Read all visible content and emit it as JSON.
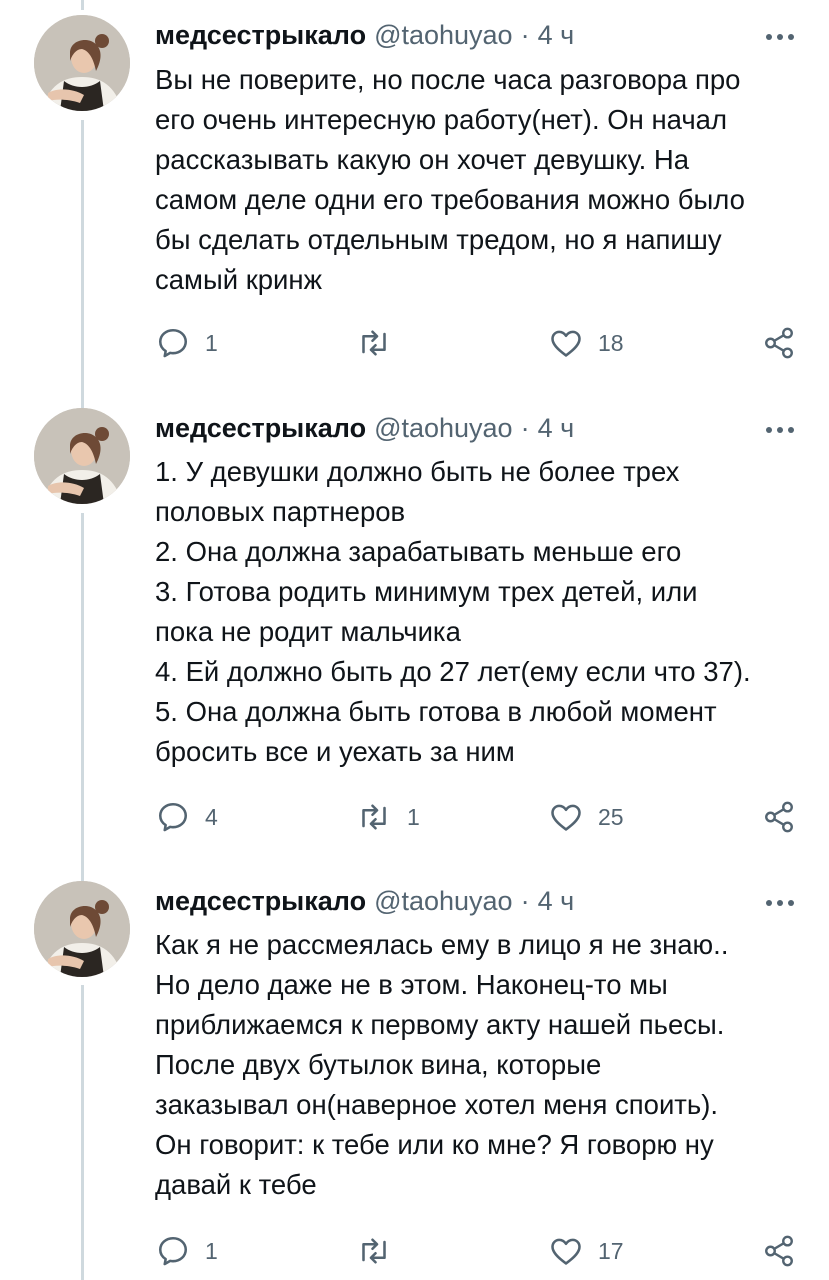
{
  "tweets": [
    {
      "name": "медсестрыкало",
      "handle": "@taohuyao",
      "separator": "·",
      "time": "4 ч",
      "lines": [
        "Вы не поверите, но после часа разговора про",
        "его очень интересную работу(нет). Он начал",
        "рассказывать какую он хочет девушку. На",
        "самом деле одни его требования можно было",
        "бы сделать отдельным тредом, но я напишу",
        "самый кринж"
      ],
      "replies": "1",
      "retweets": "",
      "likes": "18"
    },
    {
      "name": "медсестрыкало",
      "handle": "@taohuyao",
      "separator": "·",
      "time": "4 ч",
      "lines": [
        "1. У девушки должно быть не более трех",
        "половых партнеров",
        "2. Она должна зарабатывать меньше его",
        "3. Готова родить минимум трех детей, или",
        "пока не родит мальчика",
        "4. Ей должно быть до 27 лет(ему если что 37).",
        "5. Она должна быть готова в любой момент",
        "бросить все и уехать за ним"
      ],
      "replies": "4",
      "retweets": "1",
      "likes": "25"
    },
    {
      "name": "медсестрыкало",
      "handle": "@taohuyao",
      "separator": "·",
      "time": "4 ч",
      "lines": [
        "Как я не рассмеялась ему в лицо я не знаю..",
        "Но дело даже не в этом. Наконец-то мы",
        "приближаемся к первому акту нашей пьесы.",
        "После двух бутылок вина, которые",
        "заказывал он(наверное хотел меня споить).",
        "Он говорит: к тебе или ко мне? Я говорю ну",
        "давай к тебе"
      ],
      "replies": "1",
      "retweets": "",
      "likes": "17"
    }
  ],
  "icons": {
    "more": "more-dots-icon",
    "reply": "reply-icon",
    "retweet": "retweet-icon",
    "like": "heart-icon",
    "share": "share-icon"
  },
  "colors": {
    "text": "#0f1419",
    "secondary": "#536471",
    "thread_line": "#cfd9de"
  }
}
